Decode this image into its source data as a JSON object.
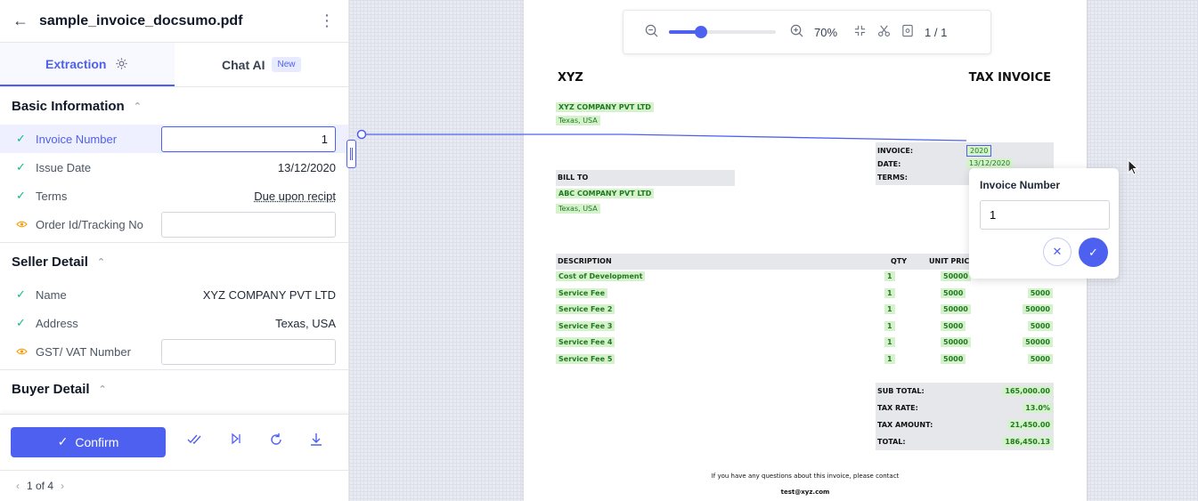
{
  "header": {
    "title": "sample_invoice_docsumo.pdf"
  },
  "tabs": [
    {
      "label": "Extraction"
    },
    {
      "label": "Chat AI",
      "badge": "New"
    }
  ],
  "sections": {
    "basic": {
      "title": "Basic Information",
      "fields": [
        {
          "label": "Invoice Number",
          "value": "1"
        },
        {
          "label": "Issue Date",
          "value": "13/12/2020"
        },
        {
          "label": "Terms",
          "value": "Due upon recipt"
        },
        {
          "label": "Order Id/Tracking No",
          "value": ""
        }
      ]
    },
    "seller": {
      "title": "Seller Detail",
      "fields": [
        {
          "label": "Name",
          "value": "XYZ COMPANY PVT LTD"
        },
        {
          "label": "Address",
          "value": "Texas, USA"
        },
        {
          "label": "GST/ VAT Number",
          "value": ""
        }
      ]
    },
    "buyer": {
      "title": "Buyer Detail"
    }
  },
  "footer": {
    "confirm_label": "Confirm",
    "pager": "1 of 4"
  },
  "toolbar": {
    "zoom": "70%",
    "zoom_level": 0.3,
    "page": "1 / 1"
  },
  "popup": {
    "title": "Invoice Number",
    "value": "1"
  },
  "doc": {
    "company": "XYZ",
    "doc_title": "TAX INVOICE",
    "seller_name": "XYZ COMPANY PVT LTD",
    "seller_addr": "Texas, USA",
    "meta_labels": [
      "INVOICE:",
      "DATE:",
      "TERMS:"
    ],
    "meta_values": [
      "2020",
      "13/12/2020"
    ],
    "bill_to": "BILL TO",
    "buyer_name": "ABC COMPANY PVT LTD",
    "buyer_addr": "Texas, USA",
    "col_desc": "DESCRIPTION",
    "col_qty": "QTY",
    "col_price": "UNIT PRICE",
    "items": [
      {
        "desc": "Cost of Development",
        "qty": "1",
        "price": "50000",
        "total": ""
      },
      {
        "desc": "Service Fee",
        "qty": "1",
        "price": "5000",
        "total": "5000"
      },
      {
        "desc": "Service Fee 2",
        "qty": "1",
        "price": "50000",
        "total": "50000"
      },
      {
        "desc": "Service Fee 3",
        "qty": "1",
        "price": "5000",
        "total": "5000"
      },
      {
        "desc": "Service Fee 4",
        "qty": "1",
        "price": "50000",
        "total": "50000"
      },
      {
        "desc": "Service Fee 5",
        "qty": "1",
        "price": "5000",
        "total": "5000"
      }
    ],
    "totals": [
      {
        "label": "SUB TOTAL:",
        "value": "165,000.00"
      },
      {
        "label": "TAX RATE:",
        "value": "13.0%"
      },
      {
        "label": "TAX AMOUNT:",
        "value": "21,450.00"
      },
      {
        "label": "TOTAL:",
        "value": "186,450.13"
      }
    ],
    "footer_note": "If you have any questions about this invoice, please contact",
    "footer_email": "test@xyz.com"
  }
}
